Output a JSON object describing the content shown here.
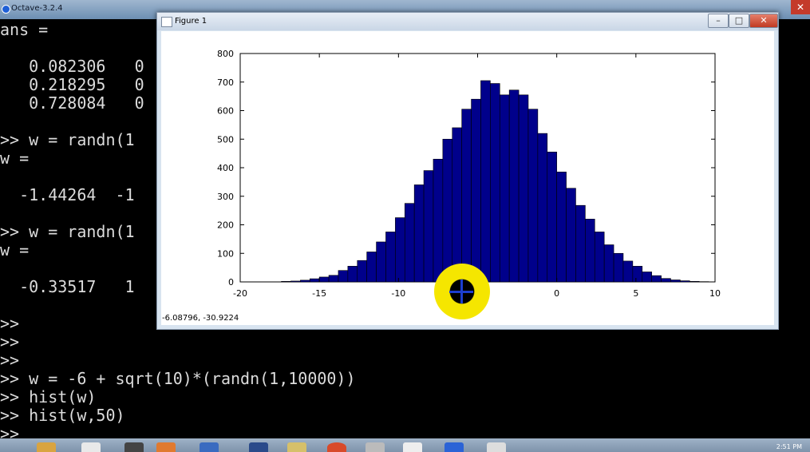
{
  "octave_window": {
    "title": "Octave-3.2.4",
    "close_label": "✕"
  },
  "console": {
    "lines": [
      "ans =",
      "",
      "   0.082306   0",
      "   0.218295   0",
      "   0.728084   0",
      "",
      ">> w = randn(1",
      "w =",
      "",
      "  -1.44264  -1",
      "",
      ">> w = randn(1",
      "w =",
      "",
      "  -0.33517   1",
      "",
      ">>",
      ">>",
      ">>",
      ">> w = -6 + sqrt(10)*(randn(1,10000))",
      ">> hist(w)",
      ">> hist(w,50)",
      ">>"
    ]
  },
  "figure_window": {
    "title": "Figure 1",
    "minimize_label": "–",
    "maximize_label": "□",
    "close_label": "✕",
    "coords_readout": "-6.08796, -30.9224"
  },
  "chart_data": {
    "type": "bar",
    "bar_color": "#00008b",
    "xlim": [
      -20,
      10
    ],
    "ylim": [
      0,
      800
    ],
    "xticks": [
      "-20",
      "-15",
      "-10",
      "-5",
      "0",
      "5",
      "10"
    ],
    "yticks": [
      "0",
      "100",
      "200",
      "300",
      "400",
      "500",
      "600",
      "700",
      "800"
    ],
    "grid": false,
    "bin_start": -17.4,
    "bin_width": 0.6,
    "values": [
      2,
      3,
      6,
      11,
      17,
      23,
      40,
      55,
      75,
      105,
      140,
      175,
      225,
      275,
      340,
      390,
      430,
      500,
      540,
      605,
      640,
      705,
      695,
      655,
      672,
      655,
      605,
      520,
      455,
      385,
      328,
      268,
      220,
      175,
      130,
      100,
      73,
      55,
      35,
      22,
      12,
      7,
      4,
      2,
      1
    ]
  },
  "taskbar": {
    "clock": "2:51 PM"
  }
}
